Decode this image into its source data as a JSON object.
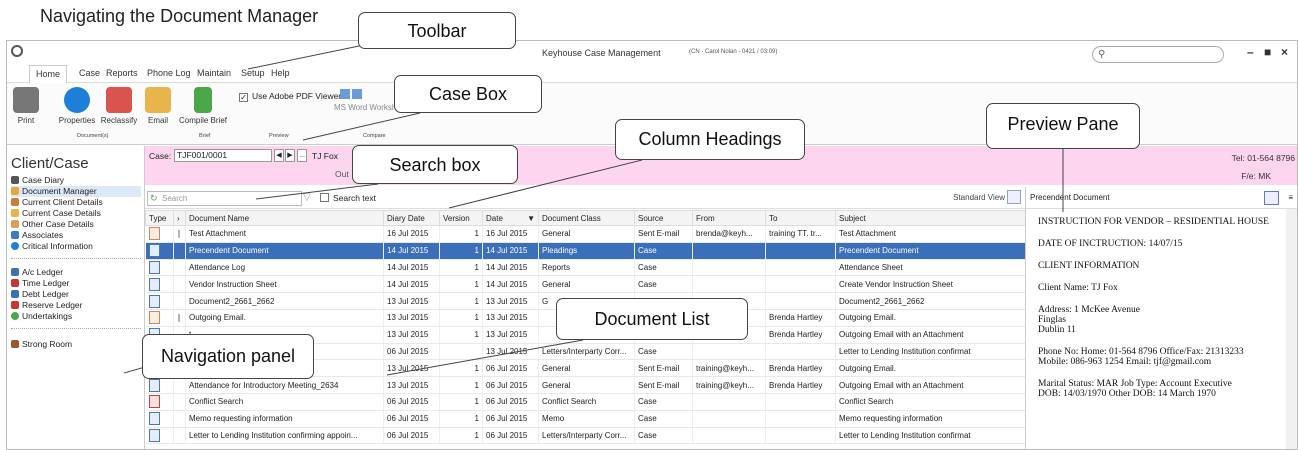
{
  "top_caption": "Navigating the Document Manager",
  "window": {
    "title": "Keyhouse Case Management",
    "subtitle": "(CN - Carol Nolan - 0421 / 03:09)",
    "search_placeholder": ""
  },
  "ribbon_tabs": [
    "Home",
    "Case",
    "Reports",
    "Phone Log",
    "Maintain",
    "Setup",
    "Help"
  ],
  "ribbon": {
    "print": "Print",
    "properties": "Properties",
    "reclassify": "Reclassify",
    "documents_group": "Document(s)",
    "email": "Email",
    "compile_brief": "Compile Brief",
    "brief_group": "Brief",
    "use_adobe": "Use Adobe PDF Viewer",
    "preview_group": "Preview",
    "ms_word_workshare": "MS Word Workshare",
    "compare_group": "Compare"
  },
  "nav": {
    "title": "Client/Case",
    "items": [
      "Case Diary",
      "Document Manager",
      "Current Client Details",
      "Current Case Details",
      "Other Case Details",
      "Associates",
      "Critical Information",
      "A/c Ledger",
      "Time Ledger",
      "Debt Ledger",
      "Reserve Ledger",
      "Undertakings",
      "Strong Room"
    ]
  },
  "case": {
    "label": "Case:",
    "value": "TJF001/0001",
    "client": "TJ Fox",
    "line2": "Out",
    "tel": "Tel: 01-564 8796",
    "fe": "F/e: MK"
  },
  "docs": {
    "search_placeholder": "Search",
    "search_text_label": "Search text",
    "view_label": "Standard View",
    "columns": [
      "Type",
      "",
      "Document Name",
      "Diary Date",
      "Version",
      "Date",
      "Document Class",
      "Source",
      "From",
      "To",
      "Subject"
    ],
    "rows": [
      {
        "icon": "mail",
        "clip": true,
        "name": "Test Attachment",
        "diary": "16 Jul 2015",
        "ver": "1",
        "date": "16 Jul 2015",
        "cls": "General",
        "src": "Sent E-mail",
        "from": "brenda@keyh...",
        "to": "training TT. tr...",
        "subj": "Test Attachment"
      },
      {
        "icon": "doc",
        "clip": false,
        "name": "Precendent Document",
        "diary": "14 Jul 2015",
        "ver": "1",
        "date": "14 Jul 2015",
        "cls": "Pleadings",
        "src": "Case",
        "from": "",
        "to": "",
        "subj": "Precendent Document"
      },
      {
        "icon": "doc",
        "clip": false,
        "name": "Attendance Log",
        "diary": "14 Jul 2015",
        "ver": "1",
        "date": "14 Jul 2015",
        "cls": "Reports",
        "src": "Case",
        "from": "",
        "to": "",
        "subj": "Attendance Sheet"
      },
      {
        "icon": "doc",
        "clip": false,
        "name": "Vendor Instruction Sheet",
        "diary": "14 Jul 2015",
        "ver": "1",
        "date": "14 Jul 2015",
        "cls": "General",
        "src": "Case",
        "from": "",
        "to": "",
        "subj": "Create Vendor Instruction Sheet"
      },
      {
        "icon": "doc",
        "clip": false,
        "name": "Document2_2661_2662",
        "diary": "13 Jul 2015",
        "ver": "1",
        "date": "13 Jul 2015",
        "cls": "G",
        "src": "",
        "from": "",
        "to": "",
        "subj": "Document2_2661_2662"
      },
      {
        "icon": "mail",
        "clip": true,
        "name": "Outgoing Email.",
        "diary": "13 Jul 2015",
        "ver": "1",
        "date": "13 Jul 2015",
        "cls": "",
        "src": "",
        "from": "ökeyh...",
        "to": "Brenda Hartley",
        "subj": "Outgoing Email."
      },
      {
        "icon": "doc",
        "clip": false,
        "name": "t",
        "diary": "13 Jul 2015",
        "ver": "1",
        "date": "13 Jul 2015",
        "cls": "",
        "src": "",
        "from": "ökeyh...",
        "to": "Brenda Hartley",
        "subj": "Outgoing Email with an Attachment"
      },
      {
        "icon": "doc",
        "clip": false,
        "name": "ming appoint...",
        "diary": "06 Jul 2015",
        "ver": "",
        "date": "13 Jul 2015",
        "cls": "Letters/Interparty Corr...",
        "src": "Case",
        "from": "",
        "to": "",
        "subj": "Letter to Lending Institution confirmat"
      },
      {
        "icon": "pdf",
        "clip": false,
        "name": "",
        "diary": "13 Jul 2015",
        "ver": "1",
        "date": "06 Jul 2015",
        "cls": "General",
        "src": "Sent E-mail",
        "from": "training@keyh...",
        "to": "Brenda Hartley",
        "subj": "Outgoing Email."
      },
      {
        "icon": "doc",
        "clip": false,
        "name": "Attendance for Introductory Meeting_2634",
        "diary": "13 Jul 2015",
        "ver": "1",
        "date": "06 Jul 2015",
        "cls": "General",
        "src": "Sent E-mail",
        "from": "training@keyh...",
        "to": "Brenda Hartley",
        "subj": "Outgoing Email with an Attachment"
      },
      {
        "icon": "pdf",
        "clip": false,
        "name": "Conflict Search",
        "diary": "06 Jul 2015",
        "ver": "1",
        "date": "06 Jul 2015",
        "cls": "Conflict Search",
        "src": "Case",
        "from": "",
        "to": "",
        "subj": "Conflict Search"
      },
      {
        "icon": "doc",
        "clip": false,
        "name": "Memo requesting information",
        "diary": "06 Jul 2015",
        "ver": "1",
        "date": "06 Jul 2015",
        "cls": "Memo",
        "src": "Case",
        "from": "",
        "to": "",
        "subj": "Memo requesting information"
      },
      {
        "icon": "doc",
        "clip": false,
        "name": "Letter to Lending Institution confirming appoin...",
        "diary": "06 Jul 2015",
        "ver": "1",
        "date": "06 Jul 2015",
        "cls": "Letters/Interparty Corr...",
        "src": "Case",
        "from": "",
        "to": "",
        "subj": "Letter to Lending Institution confirmat"
      }
    ]
  },
  "preview": {
    "header": "Precendent Document",
    "lines": [
      "INSTRUCTION FOR VENDOR – RESIDENTIAL HOUSE",
      "DATE OF INCTRUCTION: 14/07/15",
      "CLIENT INFORMATION",
      "Client Name: TJ Fox",
      "Address: 1 McKee Avenue\nFinglas\nDublin 11",
      "Phone No: Home: 01-564 8796 Office/Fax:  21313233\nMobile: 086-963 1254 Email: tjf@gmail.com",
      "Marital Status: MAR Job Type: Account Executive\nDOB: 14/03/1970 Other DOB:  14 March 1970"
    ]
  },
  "callouts": {
    "toolbar": "Toolbar",
    "case_box": "Case Box",
    "preview_pane": "Preview Pane",
    "column_headings": "Column Headings",
    "search_box": "Search box",
    "document_list": "Document List",
    "navigation_panel": "Navigation panel"
  }
}
